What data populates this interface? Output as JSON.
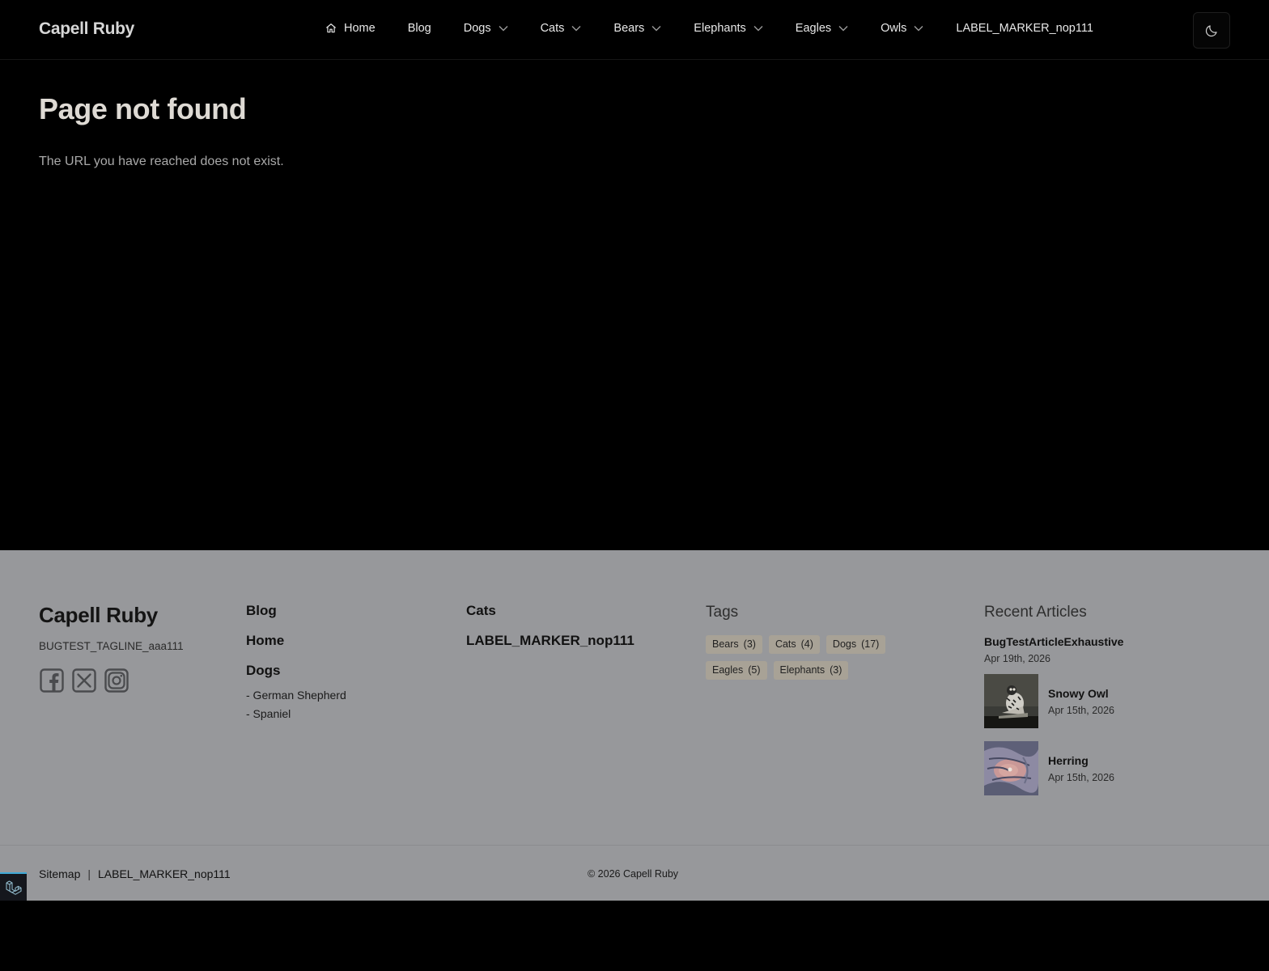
{
  "header": {
    "brand": "Capell Ruby",
    "nav": [
      {
        "label": "Home",
        "icon": "home-icon"
      },
      {
        "label": "Blog"
      },
      {
        "label": "Dogs",
        "dropdown": true
      },
      {
        "label": "Cats",
        "dropdown": true
      },
      {
        "label": "Bears",
        "dropdown": true
      },
      {
        "label": "Elephants",
        "dropdown": true
      },
      {
        "label": "Eagles",
        "dropdown": true
      },
      {
        "label": "Owls",
        "dropdown": true
      },
      {
        "label": "LABEL_MARKER_nop111"
      }
    ],
    "theme_toggle_icon": "moon-icon"
  },
  "main": {
    "title": "Page not found",
    "message": "The URL you have reached does not exist."
  },
  "footer": {
    "brand": "Capell Ruby",
    "tagline": "BUGTEST_TAGLINE_aaa111",
    "socials": [
      "facebook-icon",
      "x-icon",
      "instagram-icon"
    ],
    "col1": {
      "links": [
        "Blog",
        "Home",
        "Dogs"
      ],
      "sub_links": [
        "- German Shepherd",
        "- Spaniel"
      ]
    },
    "col2": {
      "links": [
        "Cats",
        "LABEL_MARKER_nop111"
      ]
    },
    "tags": {
      "heading": "Tags",
      "items": [
        {
          "name": "Bears",
          "count": "(3)"
        },
        {
          "name": "Cats",
          "count": "(4)"
        },
        {
          "name": "Dogs",
          "count": "(17)"
        },
        {
          "name": "Eagles",
          "count": "(5)"
        },
        {
          "name": "Elephants",
          "count": "(3)"
        }
      ]
    },
    "recent": {
      "heading": "Recent Articles",
      "articles": [
        {
          "title": "BugTestArticleExhaustive",
          "date": "Apr 19th, 2026"
        },
        {
          "title": "Snowy Owl",
          "date": "Apr 15th, 2026"
        },
        {
          "title": "Herring",
          "date": "Apr 15th, 2026"
        }
      ]
    },
    "bottom": {
      "sitemap": "Sitemap",
      "separator": "|",
      "marker": "LABEL_MARKER_nop111",
      "copyright": "© 2026 Capell Ruby"
    }
  },
  "colors": {
    "background": "#000000",
    "footer_bg": "#97989b",
    "tag_bg": "#a8a296",
    "badge_accent": "#3fa9d6"
  }
}
